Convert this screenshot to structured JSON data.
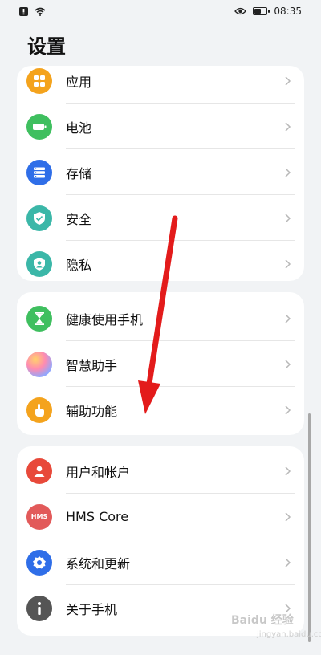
{
  "status_bar": {
    "time": "08:35",
    "battery_level": 0.5
  },
  "page": {
    "title": "设置"
  },
  "groups": [
    {
      "items": [
        {
          "label": "应用",
          "icon": "apps-icon",
          "color": "#f4a31d"
        },
        {
          "label": "电池",
          "icon": "battery-icon",
          "color": "#3fbf5f"
        },
        {
          "label": "存储",
          "icon": "storage-icon",
          "color": "#2f6ee8"
        },
        {
          "label": "安全",
          "icon": "security-shield-icon",
          "color": "#3bb7a8"
        },
        {
          "label": "隐私",
          "icon": "privacy-icon",
          "color": "#3bb7a8"
        }
      ]
    },
    {
      "items": [
        {
          "label": "健康使用手机",
          "icon": "hourglass-icon",
          "color": "#3fbf5f"
        },
        {
          "label": "智慧助手",
          "icon": "smart-assistant-icon",
          "color": "#b07cf0"
        },
        {
          "label": "辅助功能",
          "icon": "accessibility-hand-icon",
          "color": "#f4a31d"
        }
      ]
    },
    {
      "items": [
        {
          "label": "用户和帐户",
          "icon": "user-icon",
          "color": "#e8493a"
        },
        {
          "label": "HMS Core",
          "icon": "hms-icon",
          "color": "#e25a5a",
          "badge": "HMS"
        },
        {
          "label": "系统和更新",
          "icon": "settings-gear-icon",
          "color": "#2f6ee8"
        },
        {
          "label": "关于手机",
          "icon": "info-icon",
          "color": "#555555"
        }
      ]
    }
  ],
  "annotation": {
    "color": "#e31b1b"
  },
  "watermark": {
    "brand": "Baidu 经验",
    "sub": "jingyan.baidu.com"
  }
}
